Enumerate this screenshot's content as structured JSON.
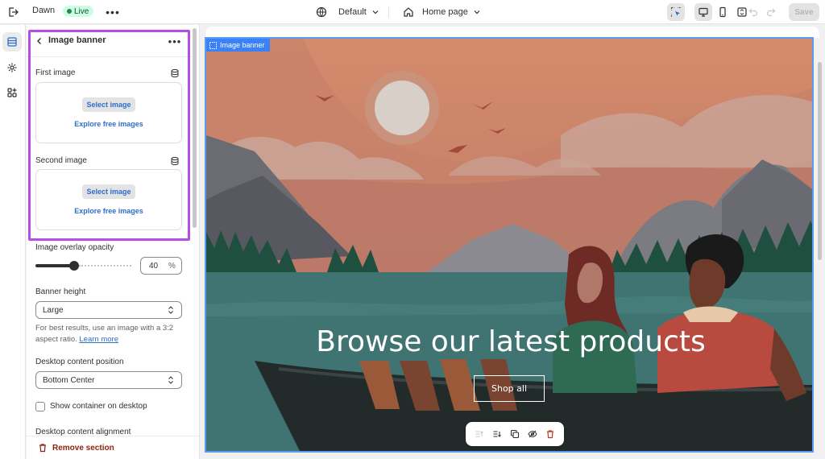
{
  "topbar": {
    "theme_name": "Dawn",
    "live_badge": "Live",
    "global_setting": "Default",
    "page_selector": "Home page",
    "save_label": "Save"
  },
  "sidebar": {
    "title": "Image banner",
    "first_image": {
      "label": "First image",
      "select_label": "Select image",
      "explore_label": "Explore free images"
    },
    "second_image": {
      "label": "Second image",
      "select_label": "Select image",
      "explore_label": "Explore free images"
    },
    "overlay_opacity": {
      "label": "Image overlay opacity",
      "value": "40",
      "unit": "%",
      "fraction": 0.4
    },
    "banner_height": {
      "label": "Banner height",
      "value": "Large",
      "help_text": "For best results, use an image with a 3:2 aspect ratio.",
      "help_link": "Learn more"
    },
    "desktop_position": {
      "label": "Desktop content position",
      "value": "Bottom Center"
    },
    "show_container": {
      "label": "Show container on desktop",
      "checked": false
    },
    "desktop_alignment": {
      "label": "Desktop content alignment"
    },
    "remove_label": "Remove section"
  },
  "preview": {
    "section_tag": "Image banner",
    "heading": "Browse our latest products",
    "button_label": "Shop all"
  },
  "colors": {
    "accent_blue": "#2c6ecb",
    "highlight_purple": "#b44ee6",
    "live_green": "#29845a",
    "danger": "#8e1f0b",
    "selection_blue": "#5b9cf0"
  }
}
